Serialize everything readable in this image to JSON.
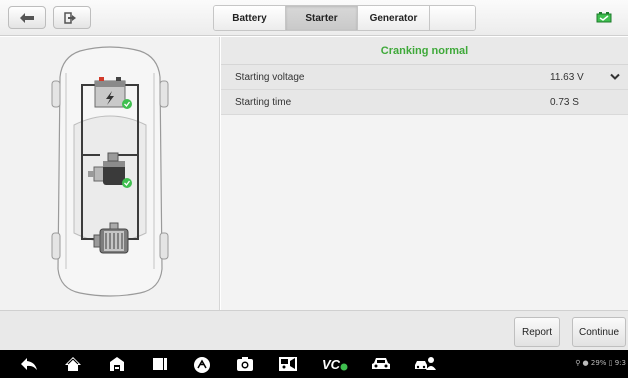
{
  "toolbar": {
    "back_icon": "back-arrow-icon",
    "exit_icon": "exit-icon",
    "battery_indicator_icon": "battery-check-icon"
  },
  "tabs": [
    {
      "label": "Battery",
      "active": false
    },
    {
      "label": "Starter",
      "active": true
    },
    {
      "label": "Generator",
      "active": false
    }
  ],
  "status": {
    "message": "Cranking normal",
    "color": "#3fa93a"
  },
  "measurements": [
    {
      "label": "Starting voltage",
      "value": "11.63 V"
    },
    {
      "label": "Starting time",
      "value": "0.73 S"
    }
  ],
  "diagram": {
    "components": [
      "battery-icon",
      "starter-motor-icon",
      "generator-icon"
    ],
    "check_color": "#3fbf4f"
  },
  "actions": {
    "report_label": "Report",
    "continue_label": "Continue"
  },
  "system_bar": {
    "icons": [
      "back-icon",
      "home-icon",
      "shop-icon",
      "recent-apps-icon",
      "browser-icon",
      "camera-icon",
      "screen-record-icon",
      "vci-icon",
      "car-icon",
      "remote-expert-icon"
    ],
    "status_text": "⚲ ● 29% ▯ 9:3"
  }
}
